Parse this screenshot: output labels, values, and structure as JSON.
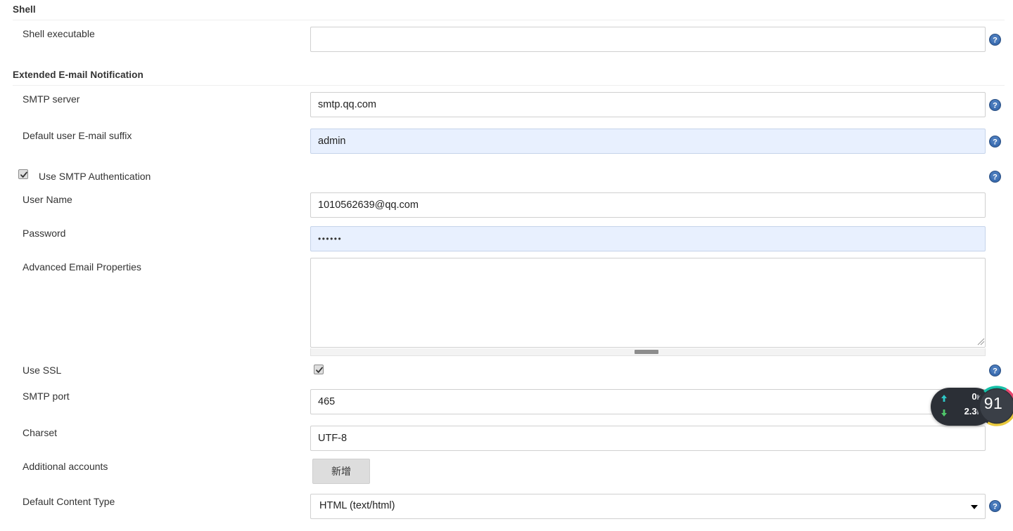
{
  "sections": [
    {
      "title": "Shell"
    },
    {
      "title": "Extended E-mail Notification"
    }
  ],
  "fields": {
    "shell_executable": {
      "label": "Shell executable",
      "value": "",
      "placeholder": ""
    },
    "smtp_server": {
      "label": "SMTP server",
      "value": "smtp.qq.com",
      "placeholder": ""
    },
    "default_user_email_suffix": {
      "label": "Default user E-mail suffix",
      "value": "admin",
      "placeholder": ""
    },
    "use_smtp_authentication": {
      "label": "Use SMTP Authentication",
      "checked": true
    },
    "user_name": {
      "label": "User Name",
      "value": "1010562639@qq.com",
      "placeholder": ""
    },
    "password": {
      "label": "Password",
      "value": "••••••",
      "placeholder": ""
    },
    "advanced_email_properties": {
      "label": "Advanced Email Properties",
      "value": "",
      "placeholder": ""
    },
    "use_ssl": {
      "label": "Use SSL",
      "checked": true
    },
    "smtp_port": {
      "label": "SMTP port",
      "value": "465",
      "placeholder": ""
    },
    "charset": {
      "label": "Charset",
      "value": "UTF-8",
      "placeholder": ""
    },
    "additional_accounts": {
      "label": "Additional accounts",
      "button_label": "新增"
    },
    "default_content_type": {
      "label": "Default Content Type",
      "value": "HTML (text/html)",
      "options": [
        "HTML (text/html)"
      ]
    }
  },
  "icons": {
    "help": "help-icon",
    "caret": "chevron-down-icon",
    "upload": "upload-arrow-icon",
    "download": "download-arrow-icon",
    "resize": "resize-handle-icon",
    "check": "check-icon"
  },
  "overlay": {
    "network": {
      "upload_value": "0",
      "upload_unit": "K/s",
      "download_value": "2.3",
      "download_unit": "K/s"
    },
    "gauge": {
      "value": "91"
    }
  },
  "colors": {
    "help_blue": "#2f5b9b",
    "autofill_blue": "#e8f0fe",
    "widget_dark": "#2b2f36",
    "ring_teal": "#16c0a8",
    "ring_pink": "#e8476f",
    "ring_yellow": "#e8c83c",
    "arrow_up": "#2ec7c7",
    "arrow_down": "#4fc76a"
  }
}
